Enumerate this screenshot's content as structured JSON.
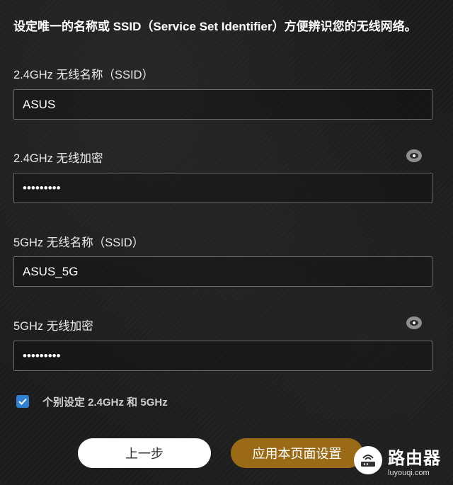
{
  "intro": {
    "text": "设定唯一的名称或 SSID（Service Set Identifier）方便辨识您的无线网络。"
  },
  "fields": {
    "ssid_24": {
      "label": "2.4GHz 无线名称（SSID）",
      "value": "ASUS"
    },
    "pwd_24": {
      "label": "2.4GHz 无线加密",
      "value": "password1"
    },
    "ssid_5": {
      "label": "5GHz 无线名称（SSID）",
      "value": "ASUS_5G"
    },
    "pwd_5": {
      "label": "5GHz 无线加密",
      "value": "password1"
    }
  },
  "separate": {
    "label": "个别设定 2.4GHz 和 5GHz",
    "checked": true
  },
  "buttons": {
    "back": "上一步",
    "apply": "应用本页面设置"
  },
  "watermark": {
    "title": "路由器",
    "url": "luyouqi.com"
  },
  "icons": {
    "show_password": "eye-icon",
    "check": "checkmark-icon",
    "watermark_logo": "router-logo-icon"
  },
  "colors": {
    "accent": "#9a6a16",
    "checkbox": "#2f7fd3"
  }
}
